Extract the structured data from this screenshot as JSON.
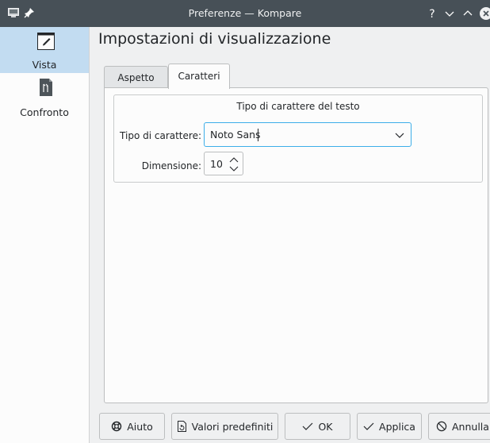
{
  "window": {
    "title": "Preferenze — Kompare",
    "controls": {
      "help": "?",
      "minimize": "chevron-down",
      "maximize": "chevron-up",
      "close": "close"
    }
  },
  "sidebar": {
    "items": [
      {
        "label": "Vista",
        "icon": "brush-icon",
        "active": true
      },
      {
        "label": "Confronto",
        "icon": "diff-file-icon",
        "active": false
      }
    ]
  },
  "page": {
    "title": "Impostazioni di visualizzazione"
  },
  "tabs": [
    {
      "label": "Aspetto",
      "active": false
    },
    {
      "label": "Caratteri",
      "active": true
    }
  ],
  "font_group": {
    "title": "Tipo di carattere del testo",
    "font_label": "Tipo di carattere:",
    "font_value": "Noto Sans",
    "size_label": "Dimensione:",
    "size_value": "10"
  },
  "buttons": {
    "help": "Aiuto",
    "defaults": "Valori predefiniti",
    "ok": "OK",
    "apply": "Applica",
    "cancel": "Annulla"
  },
  "colors": {
    "titlebar": "#475057",
    "accent": "#3daee9",
    "selection": "#c2dcf1",
    "close_button": "#eff0f1"
  }
}
